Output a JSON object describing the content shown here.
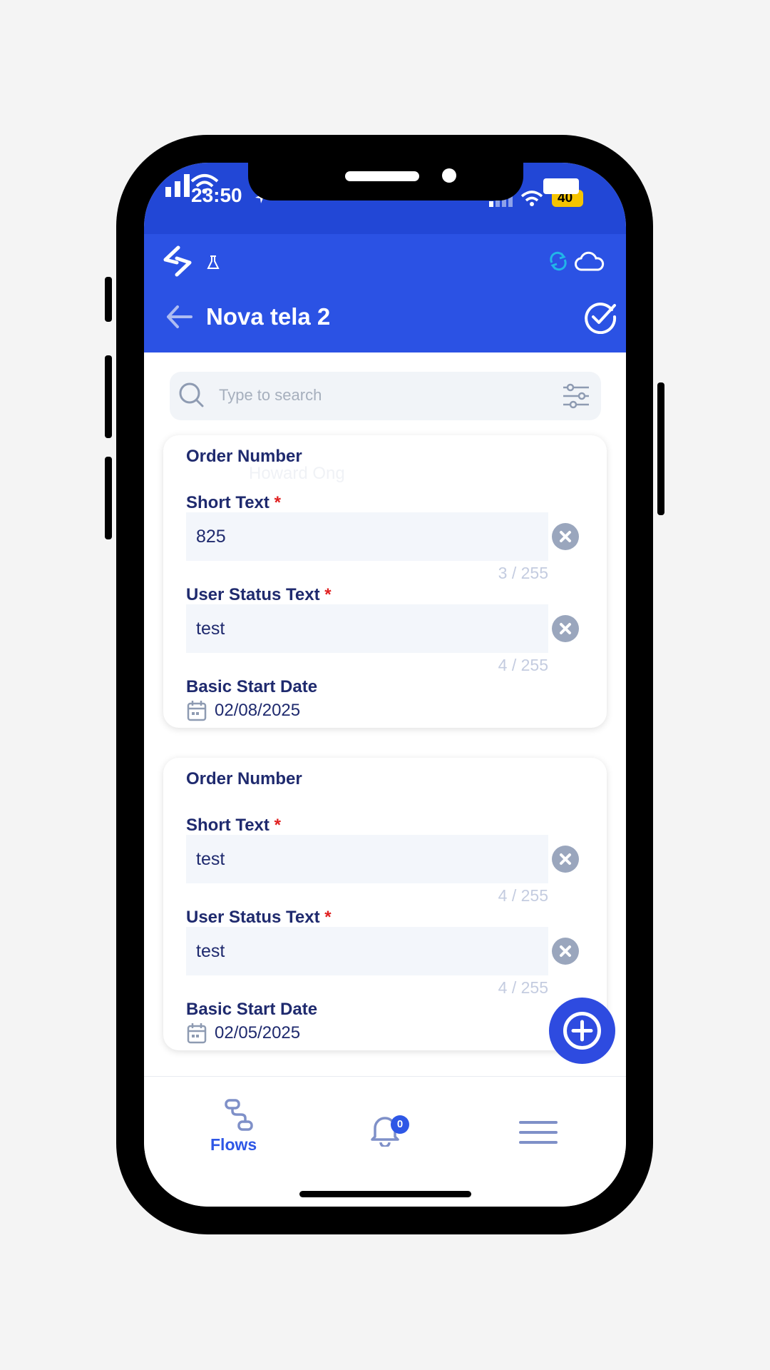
{
  "status_bar": {
    "time": "23:50",
    "battery": "40"
  },
  "header": {
    "title": "Nova tela 2"
  },
  "search": {
    "placeholder": "Type to search"
  },
  "cards": [
    {
      "order_label": "Order Number",
      "ghost_text": "Howard Ong",
      "short_text_label": "Short Text",
      "short_text_value": "825",
      "short_text_counter": "3 / 255",
      "user_status_label": "User Status Text",
      "user_status_value": "test",
      "user_status_counter": "4 / 255",
      "date_label": "Basic Start Date",
      "date_value": "02/08/2025"
    },
    {
      "order_label": "Order Number",
      "short_text_label": "Short Text",
      "short_text_value": "test",
      "short_text_counter": "4 / 255",
      "user_status_label": "User Status Text",
      "user_status_value": "test",
      "user_status_counter": "4 / 255",
      "date_label": "Basic Start Date",
      "date_value": "02/05/2025"
    }
  ],
  "required_marker": "*",
  "bottom_nav": {
    "flows_label": "Flows",
    "notifications_count": "0"
  },
  "colors": {
    "header_bg": "#2b52e4",
    "status_bg": "#2247d6",
    "accent": "#2e57e6",
    "label": "#1f2a6e",
    "required": "#e02020"
  },
  "icons": [
    "app-logo-icon",
    "flask-icon",
    "sync-icon",
    "cloud-icon",
    "back-arrow-icon",
    "check-circle-icon",
    "search-icon",
    "filter-sliders-icon",
    "clear-icon",
    "calendar-icon",
    "plus-icon",
    "flows-icon",
    "bell-icon",
    "menu-icon"
  ]
}
